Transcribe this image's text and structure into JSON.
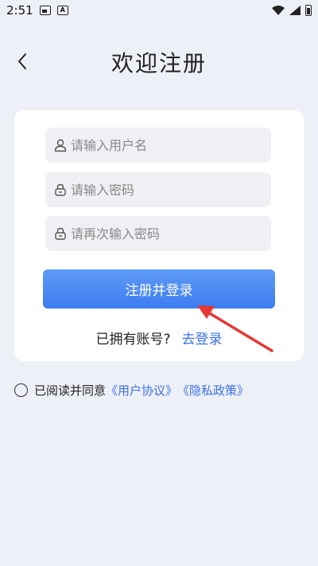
{
  "status_bar": {
    "time": "2:51"
  },
  "header": {
    "title": "欢迎注册",
    "back_icon": "chevron-left-icon"
  },
  "form": {
    "username_placeholder": "请输入用户名",
    "password_placeholder": "请输入密码",
    "confirm_placeholder": "请再次输入密码",
    "submit_label": "注册并登录",
    "login_prompt": "已拥有账号?",
    "login_link": "去登录"
  },
  "agreement": {
    "prefix": "已阅读并同意",
    "user_agreement": "《用户协议》",
    "privacy_policy": "《隐私政策》",
    "checked": false
  },
  "colors": {
    "background": "#eef0f7",
    "card": "#ffffff",
    "field": "#eff0f4",
    "button_top": "#5f9bf7",
    "button_bottom": "#3c7cf0",
    "link": "#3a73e8",
    "annotation_arrow": "#e53935"
  }
}
